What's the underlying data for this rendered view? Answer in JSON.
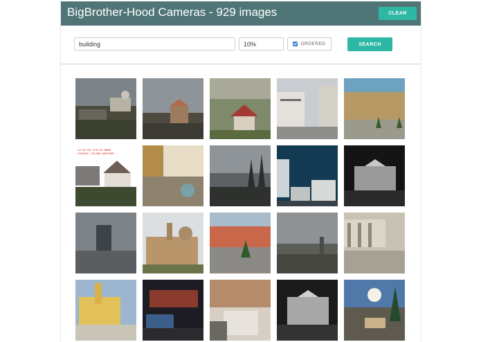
{
  "header": {
    "title": "BigBrother-Hood Cameras - 929 images",
    "clear_label": "CLEAR"
  },
  "search": {
    "query": "building",
    "percent": "10%",
    "ordered_label": "ORDERED",
    "ordered_checked": true,
    "search_label": "SEARCH"
  },
  "colors": {
    "header_bg": "#4f7577",
    "accent": "#2fb7a5",
    "checkbox": "#3b82d6"
  },
  "overlay": {
    "line1": "12:55:56 2/8/19 BRRR",
    "line2": "COASTAL ISLAND WEATHER"
  }
}
